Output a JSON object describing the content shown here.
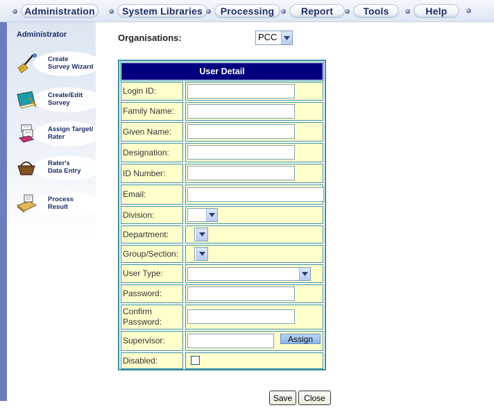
{
  "menu": {
    "items": [
      {
        "label": "Administration"
      },
      {
        "label": "System Libraries"
      },
      {
        "label": "Processing"
      },
      {
        "label": "Report"
      },
      {
        "label": "Tools"
      },
      {
        "label": "Help"
      }
    ]
  },
  "sidebar": {
    "title": "Administrator",
    "items": [
      {
        "label": "Create\nSurvey Wizard",
        "icon": "survey-wizard-broom-icon"
      },
      {
        "label": "Create/Edit\nSurvey",
        "icon": "edit-survey-book-icon"
      },
      {
        "label": "Assign Target/\nRater",
        "icon": "assign-target-papers-icon"
      },
      {
        "label": "Rater's\nData Entry",
        "icon": "data-entry-basket-icon"
      },
      {
        "label": "Process\nResult",
        "icon": "process-result-machine-icon"
      }
    ]
  },
  "organisations": {
    "label": "Organisations:",
    "selected": "PCC"
  },
  "form": {
    "title": "User Detail",
    "fields": [
      {
        "label": "Login ID:",
        "value": ""
      },
      {
        "label": "Family Name:",
        "value": ""
      },
      {
        "label": "Given Name:",
        "value": ""
      },
      {
        "label": "Designation:",
        "value": ""
      },
      {
        "label": "ID Number:",
        "value": ""
      },
      {
        "label": "Email:",
        "value": ""
      },
      {
        "label": "Division:",
        "value": ""
      },
      {
        "label": "Department:",
        "value": ""
      },
      {
        "label": "Group/Section:",
        "value": ""
      },
      {
        "label": "User Type:",
        "value": ""
      },
      {
        "label": "Password:",
        "value": ""
      },
      {
        "label": "Confirm\nPassword:",
        "value": ""
      },
      {
        "label": "Supervisor:",
        "value": ""
      },
      {
        "label": "Disabled:",
        "value": ""
      }
    ],
    "assign_label": "Assign"
  },
  "actions": {
    "save_label": "Save",
    "close_label": "Close"
  },
  "colors": {
    "menu_text": "#1c2d66",
    "form_header": "#000080",
    "row_bg": "#ffffcc",
    "row_border": "#3a8ea0",
    "left_strip": "#6b7cbf"
  }
}
